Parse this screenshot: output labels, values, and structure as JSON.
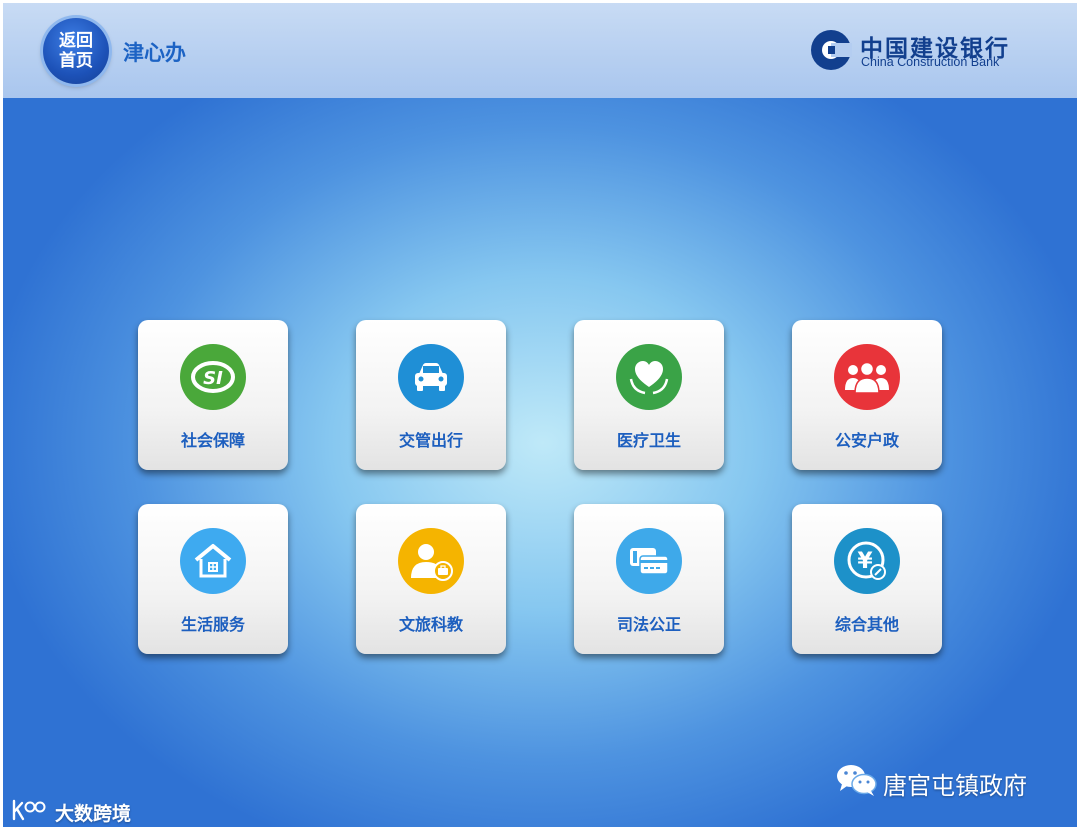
{
  "header": {
    "back_button_label": "返回首页",
    "app_title": "津心办",
    "bank_name_cn": "中国建设银行",
    "bank_name_en": "China Construction Bank"
  },
  "tiles": [
    {
      "label": "社会保障",
      "icon": "social-security-icon",
      "color": "#4aa83a"
    },
    {
      "label": "交管出行",
      "icon": "car-icon",
      "color": "#1f8fd6"
    },
    {
      "label": "医疗卫生",
      "icon": "heart-hands-icon",
      "color": "#3aa347"
    },
    {
      "label": "公安户政",
      "icon": "people-group-icon",
      "color": "#e8343a"
    },
    {
      "label": "生活服务",
      "icon": "house-icon",
      "color": "#3eaaf0"
    },
    {
      "label": "文旅科教",
      "icon": "person-badge-icon",
      "color": "#f5b400"
    },
    {
      "label": "司法公正",
      "icon": "cards-icon",
      "color": "#3ea9ea"
    },
    {
      "label": "综合其他",
      "icon": "yuan-icon",
      "color": "#1d91c9"
    }
  ],
  "footer": {
    "wechat_account": "唐官屯镇政府",
    "watermark_text": "大数跨境"
  },
  "colors": {
    "header_bg": "#b4cdf1",
    "brand_blue": "#1d63c4",
    "bank_navy": "#123f8e",
    "tile_label": "#1d5fbf"
  }
}
